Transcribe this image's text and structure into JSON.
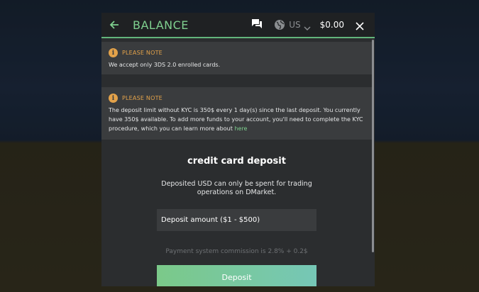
{
  "header": {
    "title": "BALANCE",
    "region": "US",
    "balance": "$0.00",
    "accent_color": "#7fd08f"
  },
  "notes": [
    {
      "title": "PLEASE NOTE",
      "text": "We accept only 3DS 2.0 enrolled cards."
    },
    {
      "title": "PLEASE NOTE",
      "text": "The deposit limit without KYC is 350$ every 1 day(s) since the last deposit. You currently have 350$ available. To add more funds to your account, you'll need to complete the KYC procedure, which you can learn more about ",
      "link": "here"
    }
  ],
  "deposit": {
    "title": "credit card deposit",
    "description": "Deposited USD can only be spent for trading operations on DMarket.",
    "amount_placeholder": "Deposit amount ($1 - $500)",
    "commission": "Payment system commission is 2.8% + 0.2$",
    "button_label": "Deposit"
  },
  "icons": [
    "arrow-left-icon",
    "chat-icon",
    "globe-icon",
    "chevron-down-icon",
    "close-icon",
    "info-icon"
  ]
}
